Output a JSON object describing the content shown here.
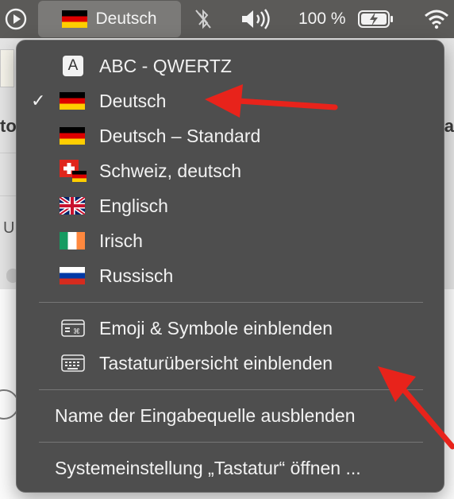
{
  "menubar": {
    "input_source_label": "Deutsch",
    "battery_percent_label": "100 %"
  },
  "background": {
    "text_left": "to",
    "text_right": "ra",
    "text_u": "U"
  },
  "menu": {
    "input_sources": [
      {
        "label": "ABC - QWERTZ",
        "icon": "abc-key-icon",
        "checked": false
      },
      {
        "label": "Deutsch",
        "icon": "german-flag-icon",
        "checked": true
      },
      {
        "label": "Deutsch – Standard",
        "icon": "german-flag-icon",
        "checked": false
      },
      {
        "label": "Schweiz, deutsch",
        "icon": "swiss-german-flag-icon",
        "checked": false
      },
      {
        "label": "Englisch",
        "icon": "uk-flag-icon",
        "checked": false
      },
      {
        "label": "Irisch",
        "icon": "irish-flag-icon",
        "checked": false
      },
      {
        "label": "Russisch",
        "icon": "russian-flag-icon",
        "checked": false
      }
    ],
    "checkmark": "✓",
    "show_emoji_label": "Emoji & Symbole einblenden",
    "show_keyboard_viewer_label": "Tastaturübersicht einblenden",
    "hide_input_source_name_label": "Name der Eingabequelle ausblenden",
    "open_keyboard_prefs_label": "Systemeinstellung „Tastatur“ öffnen ..."
  },
  "colors": {
    "menu_bg": "#4e4e4e",
    "menubar_bg": "#5b5a58",
    "arrow_red": "#e8231b"
  }
}
